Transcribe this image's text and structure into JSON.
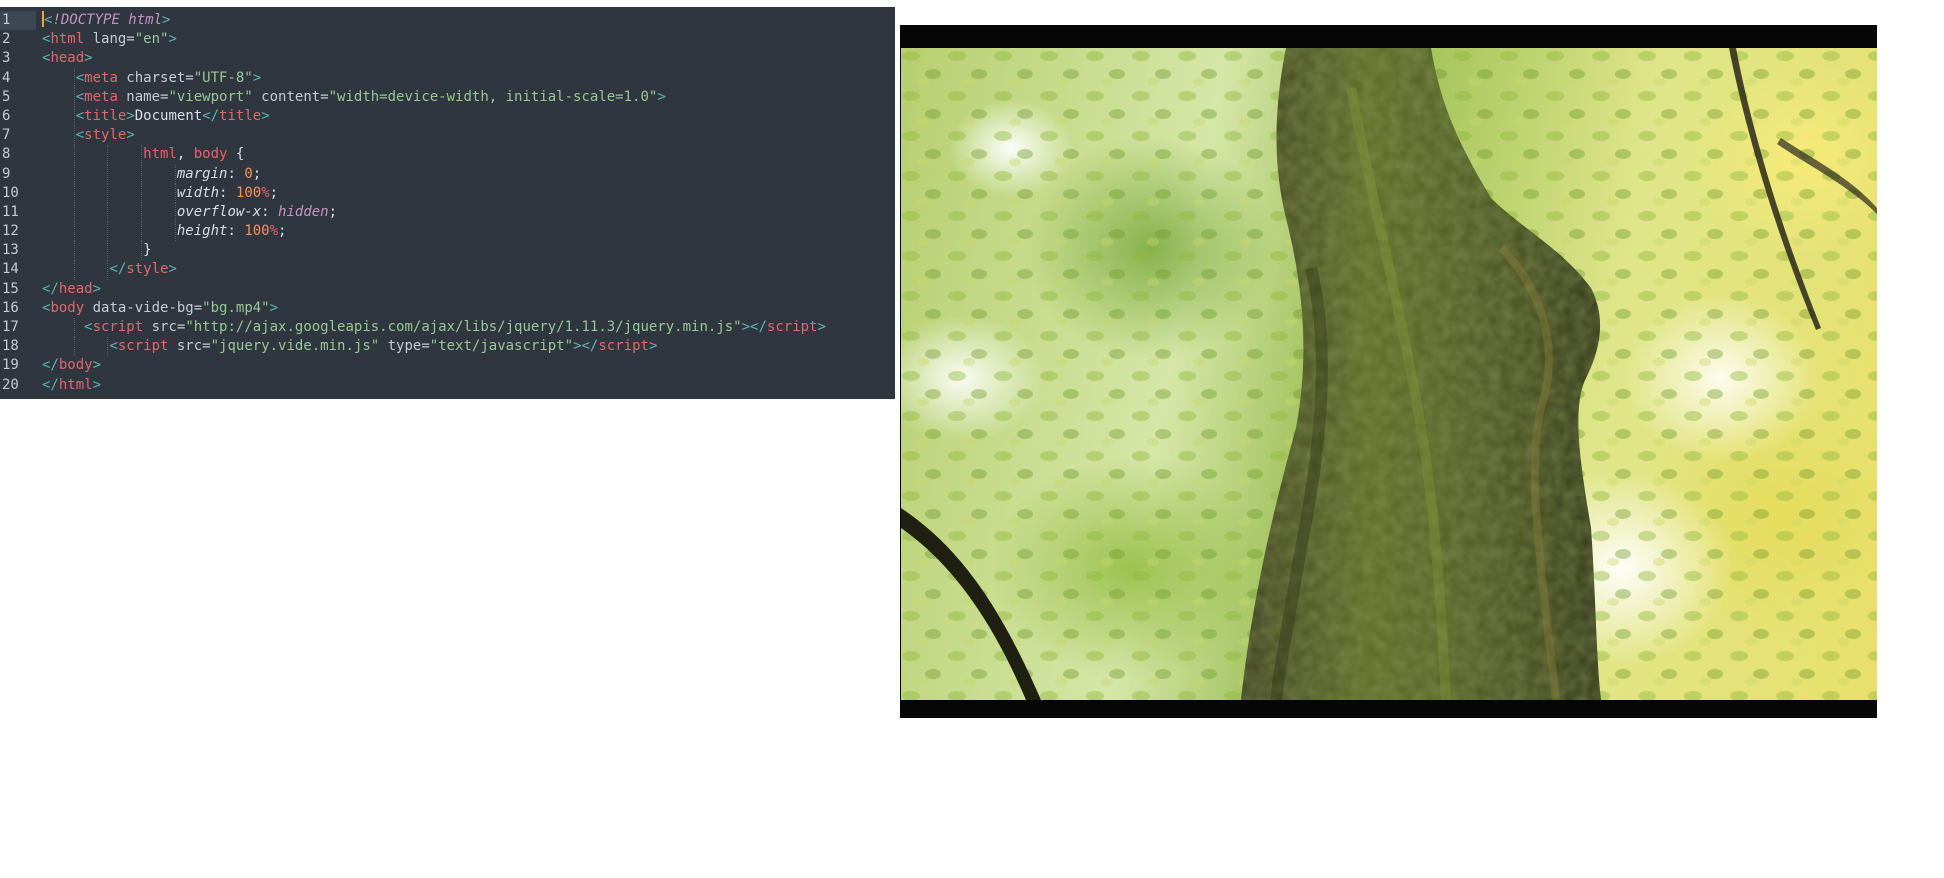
{
  "editor": {
    "current_line": 1,
    "lines": [
      {
        "n": "1",
        "indent": 0,
        "tokens": [
          [
            "t-punc",
            "<"
          ],
          [
            "t-doct",
            "!DOCTYPE "
          ],
          [
            "t-kw",
            "html"
          ],
          [
            "t-punc",
            ">"
          ]
        ]
      },
      {
        "n": "2",
        "indent": 0,
        "tokens": [
          [
            "t-punc",
            "<"
          ],
          [
            "t-tag",
            "html"
          ],
          [
            "t-attr",
            " lang="
          ],
          [
            "t-str",
            "\"en\""
          ],
          [
            "t-punc",
            ">"
          ]
        ]
      },
      {
        "n": "3",
        "indent": 0,
        "tokens": [
          [
            "t-punc",
            "<"
          ],
          [
            "t-tag",
            "head"
          ],
          [
            "t-punc",
            ">"
          ]
        ]
      },
      {
        "n": "4",
        "indent": 1,
        "tokens": [
          [
            "t-punc",
            "<"
          ],
          [
            "t-tag",
            "meta"
          ],
          [
            "t-attr",
            " charset="
          ],
          [
            "t-str",
            "\"UTF-8\""
          ],
          [
            "t-punc",
            ">"
          ]
        ]
      },
      {
        "n": "5",
        "indent": 1,
        "tokens": [
          [
            "t-punc",
            "<"
          ],
          [
            "t-tag",
            "meta"
          ],
          [
            "t-attr",
            " name="
          ],
          [
            "t-str",
            "\"viewport\""
          ],
          [
            "t-attr",
            " content="
          ],
          [
            "t-str",
            "\"width=device-width, initial-scale=1.0\""
          ],
          [
            "t-punc",
            ">"
          ]
        ]
      },
      {
        "n": "6",
        "indent": 1,
        "tokens": [
          [
            "t-punc",
            "<"
          ],
          [
            "t-tag",
            "title"
          ],
          [
            "t-punc",
            ">"
          ],
          [
            "t-text",
            "Document"
          ],
          [
            "t-punc",
            "</"
          ],
          [
            "t-tag",
            "title"
          ],
          [
            "t-punc",
            ">"
          ]
        ]
      },
      {
        "n": "7",
        "indent": 1,
        "tokens": [
          [
            "t-punc",
            "<"
          ],
          [
            "t-tag",
            "style"
          ],
          [
            "t-punc",
            ">"
          ]
        ]
      },
      {
        "n": "8",
        "indent": 3,
        "tokens": [
          [
            "t-sel",
            "html"
          ],
          [
            "t-brace",
            ", "
          ],
          [
            "t-sel",
            "body"
          ],
          [
            "t-brace",
            " {"
          ]
        ]
      },
      {
        "n": "9",
        "indent": 4,
        "tokens": [
          [
            "t-prop",
            "margin"
          ],
          [
            "t-brace",
            ": "
          ],
          [
            "t-num",
            "0"
          ],
          [
            "t-brace",
            ";"
          ]
        ]
      },
      {
        "n": "10",
        "indent": 4,
        "tokens": [
          [
            "t-prop",
            "width"
          ],
          [
            "t-brace",
            ": "
          ],
          [
            "t-num",
            "100"
          ],
          [
            "t-unit",
            "%"
          ],
          [
            "t-brace",
            ";"
          ]
        ]
      },
      {
        "n": "11",
        "indent": 4,
        "tokens": [
          [
            "t-prop",
            "overflow-x"
          ],
          [
            "t-brace",
            ": "
          ],
          [
            "t-kw",
            "hidden"
          ],
          [
            "t-brace",
            ";"
          ]
        ]
      },
      {
        "n": "12",
        "indent": 4,
        "tokens": [
          [
            "t-prop",
            "height"
          ],
          [
            "t-brace",
            ": "
          ],
          [
            "t-num",
            "100"
          ],
          [
            "t-unit",
            "%"
          ],
          [
            "t-brace",
            ";"
          ]
        ]
      },
      {
        "n": "13",
        "indent": 3,
        "tokens": [
          [
            "t-brace",
            "}"
          ]
        ]
      },
      {
        "n": "14",
        "indent": 2,
        "tokens": [
          [
            "t-punc",
            "</"
          ],
          [
            "t-tag",
            "style"
          ],
          [
            "t-punc",
            ">"
          ]
        ]
      },
      {
        "n": "15",
        "indent": 0,
        "tokens": [
          [
            "t-punc",
            "</"
          ],
          [
            "t-tag",
            "head"
          ],
          [
            "t-punc",
            ">"
          ]
        ]
      },
      {
        "n": "16",
        "indent": 0,
        "tokens": [
          [
            "t-punc",
            "<"
          ],
          [
            "t-tag",
            "body"
          ],
          [
            "t-attr",
            " data-vide-bg="
          ],
          [
            "t-str",
            "\"bg.mp4\""
          ],
          [
            "t-punc",
            ">"
          ]
        ]
      },
      {
        "n": "17",
        "indent": 1.25,
        "tokens": [
          [
            "t-punc",
            "<"
          ],
          [
            "t-tag",
            "script"
          ],
          [
            "t-attr",
            " src="
          ],
          [
            "t-str",
            "\"http://ajax.googleapis.com/ajax/libs/jquery/1.11.3/jquery.min.js\""
          ],
          [
            "t-punc",
            "></"
          ],
          [
            "t-tag",
            "script"
          ],
          [
            "t-punc",
            ">"
          ]
        ]
      },
      {
        "n": "18",
        "indent": 2,
        "tokens": [
          [
            "t-punc",
            "<"
          ],
          [
            "t-tag",
            "script"
          ],
          [
            "t-attr",
            " src="
          ],
          [
            "t-str",
            "\"jquery.vide.min.js\""
          ],
          [
            "t-attr",
            " type="
          ],
          [
            "t-str",
            "\"text/javascript\""
          ],
          [
            "t-punc",
            "></"
          ],
          [
            "t-tag",
            "script"
          ],
          [
            "t-punc",
            ">"
          ]
        ]
      },
      {
        "n": "19",
        "indent": 0,
        "tokens": [
          [
            "t-punc",
            "</"
          ],
          [
            "t-tag",
            "body"
          ],
          [
            "t-punc",
            ">"
          ]
        ]
      },
      {
        "n": "20",
        "indent": 0,
        "tokens": [
          [
            "t-punc",
            "</"
          ],
          [
            "t-tag",
            "html"
          ],
          [
            "t-punc",
            ">"
          ]
        ]
      }
    ]
  },
  "video": {
    "subject": "moss-covered tree trunk in forest",
    "colors": {
      "letterbox": "#060606",
      "trunk": "#4b5228",
      "moss": "#5d7a23"
    }
  }
}
